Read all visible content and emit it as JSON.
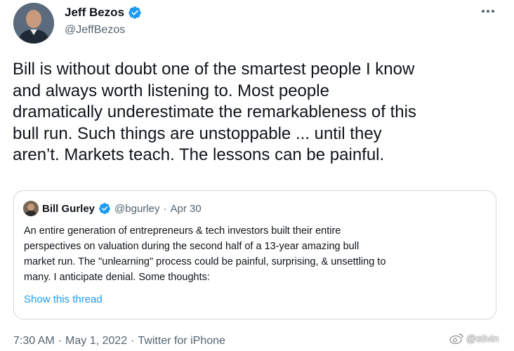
{
  "author": {
    "name": "Jeff Bezos",
    "handle": "@JeffBezos",
    "avatar_icon": "avatar-photo",
    "verified_icon": "verified-badge-icon"
  },
  "menu_icon": "more-options-icon",
  "tweet": {
    "text": "Bill is without doubt one of the smartest people I know\nand always worth listening to. Most people\ndramatically underestimate the remarkableness of this\nbull run. Such things are unstoppable ... until they\naren’t.  Markets teach. The lessons can be painful."
  },
  "quoted_tweet": {
    "name": "Bill Gurley",
    "handle": "@bgurley",
    "separator": "·",
    "date": "Apr 30",
    "text": "An entire generation of entrepreneurs & tech investors built their entire\nperspectives on valuation during the second  half of a 13-year amazing bull\nmarket run. The \"unlearning\" process could be painful, surprising, & unsettling to\nmany. I anticipate denial. Some thoughts:",
    "show_thread_label": "Show this thread"
  },
  "meta": {
    "time": "7:30 AM",
    "separator1": "·",
    "date": "May 1, 2022",
    "separator2": "·",
    "source": "Twitter for iPhone"
  },
  "watermark": {
    "text": "@stivin",
    "icon": "weibo-icon"
  },
  "colors": {
    "accent": "#1d9bf0",
    "text": "#0f1419",
    "secondary": "#536471",
    "border": "#cfd9de"
  }
}
